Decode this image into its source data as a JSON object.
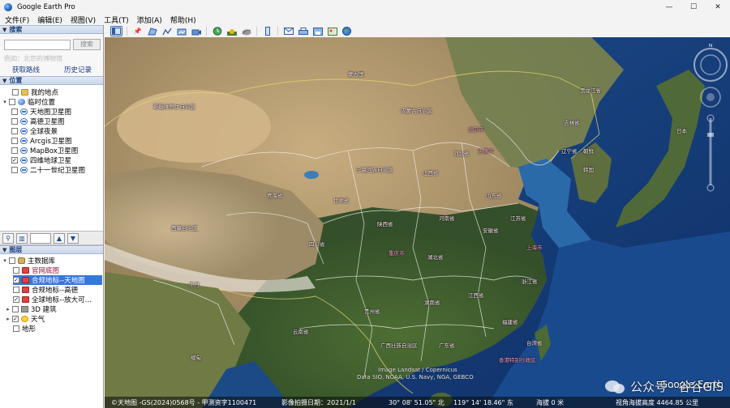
{
  "window": {
    "title": "Google Earth Pro",
    "minimize": "—",
    "maximize": "☐",
    "close": "✕"
  },
  "menu": [
    "文件(F)",
    "编辑(E)",
    "视图(V)",
    "工具(T)",
    "添加(A)",
    "帮助(H)"
  ],
  "search": {
    "header": "搜索",
    "button": "搜索",
    "hint": "例如：北京的博物馆",
    "get_directions": "获取路线",
    "history": "历史记录"
  },
  "places": {
    "header": "位置",
    "items": [
      {
        "label": "我的地点",
        "checked": false,
        "icon": "folder-icon"
      },
      {
        "label": "临时位置",
        "checked": false,
        "icon": "globe-icon"
      },
      {
        "label": "天地图卫星图",
        "checked": false,
        "icon": "link-icon"
      },
      {
        "label": "高德卫星图",
        "checked": false,
        "icon": "link-icon"
      },
      {
        "label": "全球夜景",
        "checked": false,
        "icon": "link-icon"
      },
      {
        "label": "Arcgis卫星图",
        "checked": false,
        "icon": "link-icon"
      },
      {
        "label": "MapBox卫星图",
        "checked": false,
        "icon": "link-icon"
      },
      {
        "label": "四维地球卫星",
        "checked": true,
        "icon": "link-icon"
      },
      {
        "label": "二十一世纪卫星图",
        "checked": false,
        "icon": "link-icon"
      }
    ]
  },
  "layers": {
    "header": "图层",
    "items": [
      {
        "label": "主数据库",
        "checked": false,
        "icon": "database-icon"
      },
      {
        "label": "官网底图",
        "checked": false,
        "icon": "red-square-icon"
      },
      {
        "label": "合规地标--天地图",
        "checked": true,
        "icon": "red-square-icon",
        "selected": true
      },
      {
        "label": "合规地标--高德",
        "checked": false,
        "icon": "red-square-icon"
      },
      {
        "label": "全球地标--放大可…",
        "checked": true,
        "icon": "red-square-icon"
      },
      {
        "label": "3D 建筑",
        "checked": false,
        "icon": "building-icon"
      },
      {
        "label": "天气",
        "checked": true,
        "icon": "sun-icon"
      },
      {
        "label": "地形",
        "checked": false,
        "icon": "none"
      }
    ]
  },
  "map": {
    "labels": {
      "neimenggu": "内蒙古自治区",
      "liaoning": "辽宁省",
      "jilin": "吉林省",
      "heilongjiang": "黑龙江省",
      "hebei": "河北省",
      "tianjin": "天津市",
      "beijing": "北京市",
      "shandong": "山东省",
      "shanxi": "山西省",
      "ningxia": "宁夏回族自治区",
      "gansu": "甘肃省",
      "qinghai": "青海省",
      "shaanxi": "陕西省",
      "henan": "河南省",
      "jiangsu": "江苏省",
      "anhui": "安徽省",
      "shanghai": "上海市",
      "hubei": "湖北省",
      "zhejiang": "浙江省",
      "chongqing": "重庆市",
      "sichuan": "四川省",
      "hunan": "湖南省",
      "jiangxi": "江西省",
      "fujian": "福建省",
      "guizhou": "贵州省",
      "yunnan": "云南省",
      "guangxi": "广西壮族自治区",
      "guangdong": "广东省",
      "hongkong": "香港特别行政区",
      "xizang": "西藏自治区",
      "xinjiang": "新疆维吾尔自治区",
      "korea_n": "朝鲜",
      "korea_s": "韩国",
      "japan": "日本",
      "mongolia": "蒙古国",
      "taiwan": "台湾省",
      "bhutan": "不丹",
      "myanmar": "缅甸"
    },
    "attribution_1": "Image Landsat / Copernicus",
    "attribution_2": "Data SIO, NOAA, U.S. Navy, NGA, GEBCO",
    "logo": "Google Earth",
    "watermark": "公众号 · 谷谷GIS",
    "status": {
      "copyright": "©天地图 -GS(2024)0568号 - 甲测资字1100471",
      "date": "影像拍摄日期：2021/1/1",
      "lat": "30° 08' 51.05\" 北",
      "lon": "119° 14' 18.46\" 东",
      "elev": "海拔 0 米",
      "eye_alt": "视角海拔高度 4464.85 公里"
    },
    "compass_n": "N"
  }
}
